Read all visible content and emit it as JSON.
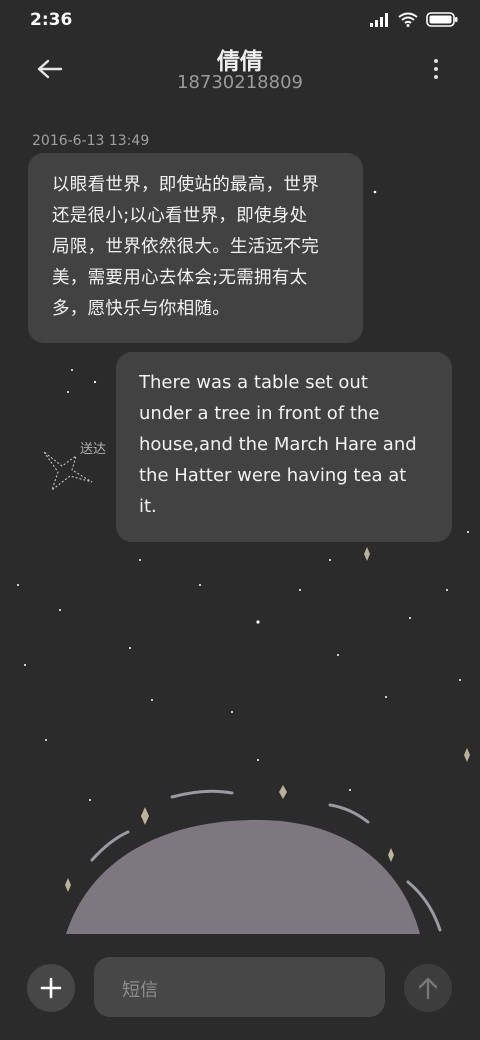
{
  "status_bar": {
    "time": "2:36",
    "icons": [
      "signal-icon",
      "wifi-icon",
      "battery-icon"
    ]
  },
  "header": {
    "back_icon": "back-arrow-icon",
    "contact_name": "倩倩",
    "contact_number": "18730218809",
    "more_icon": "more-vertical-icon"
  },
  "messages": [
    {
      "direction": "incoming",
      "timestamp": "2016-6-13 13:49",
      "lines": [
        "以眼看世界，即使站的最高，世界",
        "还是很小;以心看世界，即使身处",
        "局限，世界依然很大。生活远不完",
        "美，需要用心去体会;无需拥有太",
        "多，愿快乐与你相随。"
      ]
    },
    {
      "direction": "outgoing",
      "status": "送达",
      "lines": [
        "There was a table set out",
        "under a tree in front of the",
        "house,and the March Hare and",
        "the Hatter were having tea at",
        "it."
      ]
    }
  ],
  "composer": {
    "add_icon": "plus-icon",
    "placeholder": "短信",
    "send_icon": "send-arrow-icon"
  },
  "colors": {
    "background": "#2b2b2b",
    "bubble": "#424242",
    "input": "#474747",
    "planet": "#7d7780"
  }
}
